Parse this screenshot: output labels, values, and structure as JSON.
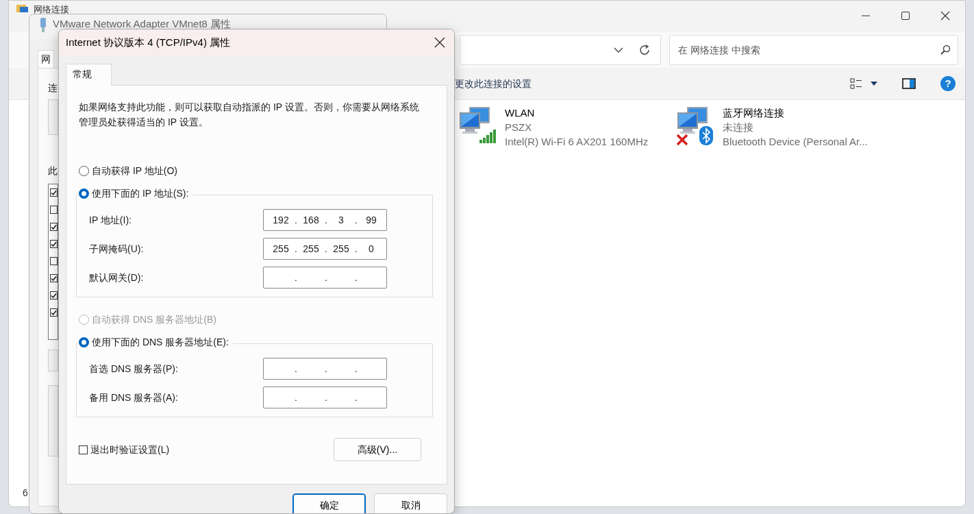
{
  "explorer": {
    "title": "网络连接",
    "search": {
      "placeholder": "在 网络连接 中搜索"
    },
    "command": "更改此连接的设置",
    "help_label": "?",
    "status": "6",
    "connections": [
      {
        "name": "WLAN",
        "network": "PSZX",
        "device": "Intel(R) Wi-Fi 6 AX201 160MHz",
        "kind": "wifi",
        "connected": true
      },
      {
        "name": "蓝牙网络连接",
        "network": "未连接",
        "device": "Bluetooth Device (Personal Ar...",
        "kind": "bluetooth",
        "connected": false
      }
    ]
  },
  "adapter_window": {
    "title": "VMware Network Adapter VMnet8 属性",
    "tab": "网",
    "label_1": "连",
    "label_2": "此",
    "components": [
      {
        "checked": true
      },
      {
        "checked": false
      },
      {
        "checked": true
      },
      {
        "checked": true
      },
      {
        "checked": false
      },
      {
        "checked": true
      },
      {
        "checked": true
      },
      {
        "checked": true
      }
    ]
  },
  "dialog": {
    "title": "Internet 协议版本 4 (TCP/IPv4) 属性",
    "tabs": [
      {
        "label": "常规",
        "selected": true
      }
    ],
    "description": "如果网络支持此功能，则可以获取自动指派的 IP 设置。否则，你需要从网络系统管理员处获得适当的 IP 设置。",
    "ip_mode": [
      {
        "label": "自动获得 IP 地址(O)",
        "selected": false,
        "disabled": false
      },
      {
        "label": "使用下面的 IP 地址(S):",
        "selected": true,
        "disabled": false
      }
    ],
    "ip_fields": [
      {
        "label": "IP 地址(I):",
        "dot": ".",
        "octets": [
          "192",
          "168",
          "3",
          "99"
        ]
      },
      {
        "label": "子网掩码(U):",
        "dot": ".",
        "octets": [
          "255",
          "255",
          "255",
          "0"
        ]
      },
      {
        "label": "默认网关(D):",
        "dot": "."
      }
    ],
    "dns_mode": [
      {
        "label": "自动获得 DNS 服务器地址(B)",
        "selected": false,
        "disabled": true
      },
      {
        "label": "使用下面的 DNS 服务器地址(E):",
        "selected": true,
        "disabled": false
      }
    ],
    "dns_fields": [
      {
        "label": "首选 DNS 服务器(P):",
        "dot": "."
      },
      {
        "label": "备用 DNS 服务器(A):",
        "dot": "."
      }
    ],
    "validate": {
      "label": "退出时验证设置(L)",
      "checked": false
    },
    "advanced_button": "高级(V)...",
    "buttons": [
      {
        "label": "确定",
        "kind": "default"
      },
      {
        "label": "取消",
        "kind": "normal"
      }
    ]
  }
}
